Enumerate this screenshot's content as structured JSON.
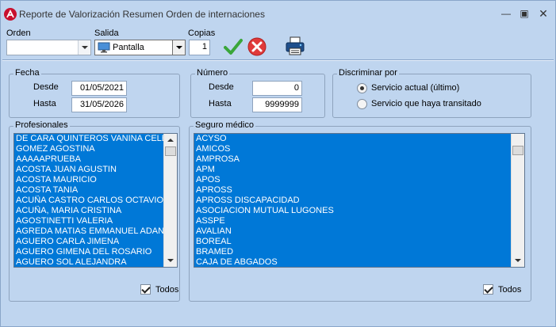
{
  "window": {
    "title": "Reporte de Valorización Resumen Orden de internaciones"
  },
  "toolbar": {
    "orden_label": "Orden",
    "orden_value": "",
    "salida_label": "Salida",
    "salida_value": "Pantalla",
    "copias_label": "Copias",
    "copias_value": "1",
    "confirm_icon": "check-icon",
    "cancel_icon": "cancel-icon",
    "print_icon": "printer-icon"
  },
  "fecha": {
    "title": "Fecha",
    "desde_label": "Desde",
    "desde_value": "01/05/2021",
    "hasta_label": "Hasta",
    "hasta_value": "31/05/2026"
  },
  "numero": {
    "title": "Número",
    "desde_label": "Desde",
    "desde_value": "0",
    "hasta_label": "Hasta",
    "hasta_value": "9999999"
  },
  "discriminar": {
    "title": "Discriminar por",
    "options": [
      "Servicio actual (último)",
      "Servicio que haya transitado"
    ],
    "selected": "Servicio actual (último)"
  },
  "profesionales": {
    "title": "Profesionales",
    "items": [
      "DE CARA QUINTEROS VANINA CELESTE",
      "GOMEZ AGOSTINA",
      "AAAAAPRUEBA",
      "ACOSTA JUAN AGUSTIN",
      "ACOSTA MAURICIO",
      "ACOSTA TANIA",
      "ACUÑA CASTRO CARLOS OCTAVIO",
      "ACUÑA, MARIA CRISTINA",
      "AGOSTINETTI VALERIA",
      "AGREDA MATIAS EMMANUEL ADAN",
      "AGUERO CARLA JIMENA",
      "AGUERO GIMENA DEL ROSARIO",
      "AGUERO SOL ALEJANDRA"
    ],
    "todos_label": "Todos"
  },
  "seguro": {
    "title": "Seguro médico",
    "items": [
      "ACYSO",
      "AMICOS",
      "AMPROSA",
      "APM",
      "APOS",
      "APROSS",
      "APROSS DISCAPACIDAD",
      "ASOCIACION MUTUAL LUGONES",
      "ASSPE",
      "AVALIAN",
      "BOREAL",
      "BRAMED",
      "CAJA DE ABGADOS"
    ],
    "todos_label": "Todos"
  },
  "colors": {
    "window_bg": "#bfd5ef",
    "list_selection": "#0078d7",
    "confirm": "#3aa63a",
    "cancel": "#e03a3a"
  }
}
